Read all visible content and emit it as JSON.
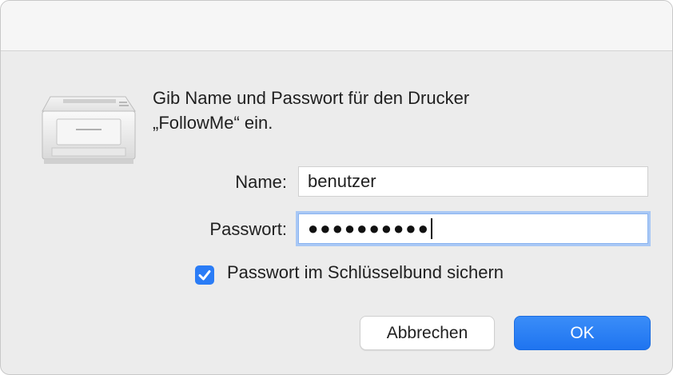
{
  "dialog": {
    "message_line1": "Gib Name und Passwort für den Drucker",
    "message_line2": "„FollowMe“ ein.",
    "icon": "printer-icon"
  },
  "form": {
    "name_label": "Name:",
    "name_value": "benutzer",
    "password_label": "Passwort:",
    "password_masked": "●●●●●●●●●●",
    "remember_checked": true,
    "remember_label": "Passwort im Schlüsselbund sichern"
  },
  "buttons": {
    "cancel_label": "Abbrechen",
    "ok_label": "OK"
  },
  "colors": {
    "accent": "#2a7cf6",
    "focus_ring": "#a9c8f5",
    "window_bg": "#ececec"
  }
}
